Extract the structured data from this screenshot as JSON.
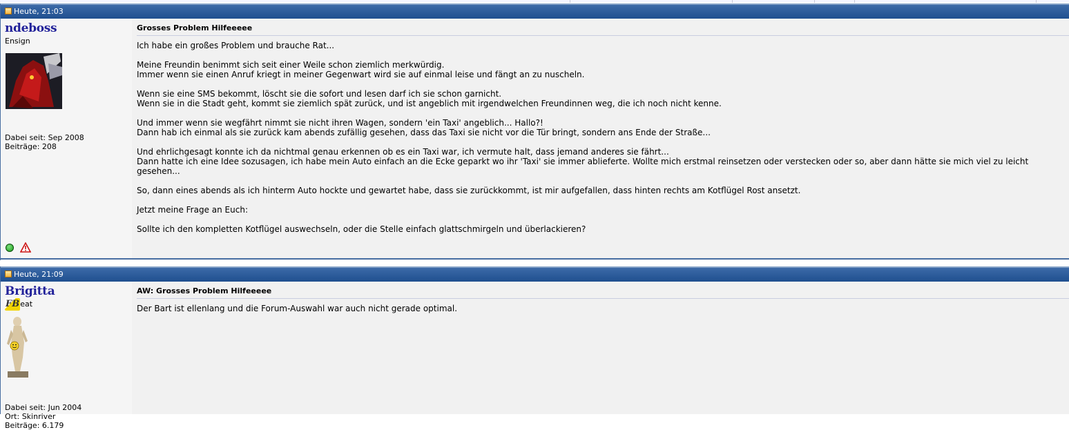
{
  "posts": [
    {
      "date": "Heute, 21:03",
      "username": "ndeboss",
      "rank": "Ensign",
      "joined": "Dabei seit: Sep 2008",
      "posts_count": "Beiträge: 208",
      "title": "Grosses Problem Hilfeeeee",
      "paragraphs": [
        "Ich habe ein großes Problem und brauche Rat...",
        "Meine Freundin benimmt sich seit einer Weile schon ziemlich merkwürdig.\nImmer wenn sie einen Anruf kriegt in meiner Gegenwart wird sie auf einmal leise und fängt an zu nuscheln.",
        "Wenn sie eine SMS bekommt, löscht sie die sofort und lesen darf ich sie schon garnicht.\nWenn sie in die Stadt geht, kommt sie ziemlich spät zurück, und ist angeblich mit irgendwelchen Freundinnen weg, die ich noch nicht kenne.",
        "Und immer wenn sie wegfährt nimmt sie nicht ihren Wagen, sondern 'ein Taxi' angeblich... Hallo?!\nDann hab ich einmal als sie zurück kam abends zufällig gesehen, dass das Taxi sie nicht vor die Tür bringt, sondern ans Ende der Straße...",
        "Und ehrlichgesagt konnte ich da nichtmal genau erkennen ob es ein Taxi war, ich vermute halt, dass jemand anderes sie fährt...\nDann hatte ich eine Idee sozusagen, ich habe mein Auto einfach an die Ecke geparkt wo ihr 'Taxi' sie immer ablieferte. Wollte mich erstmal reinsetzen oder verstecken oder so, aber dann hätte sie mich viel zu leicht gesehen...",
        "So, dann eines abends als ich hinterm Auto hockte und gewartet habe, dass sie zurückkommt, ist mir aufgefallen, dass hinten rechts am Kotflügel Rost ansetzt.",
        "Jetzt meine Frage an Euch:",
        "Sollte ich den kompletten Kotflügel auswechseln, oder die Stelle einfach glattschmirgeln und überlackieren?"
      ],
      "icons": [
        "online-status-icon",
        "report-warning-icon"
      ]
    },
    {
      "date": "Heute, 21:09",
      "username": "Brigitta",
      "rank_logo_text": "FB",
      "rank_suffix": "eat",
      "joined": "Dabei seit: Jun 2004",
      "location": "Ort: Skinriver",
      "posts_count": "Beiträge: 6.179",
      "title": "AW: Grosses Problem Hilfeeeee",
      "paragraphs": [
        "Der Bart ist ellenlang und die Forum-Auswahl war auch nicht gerade optimal."
      ]
    }
  ],
  "colors": {
    "header_bar": "#1f4f8f",
    "username": "#22229a",
    "post_bg": "#f1f1f1",
    "userinfo_bg": "#f5f5f5"
  }
}
